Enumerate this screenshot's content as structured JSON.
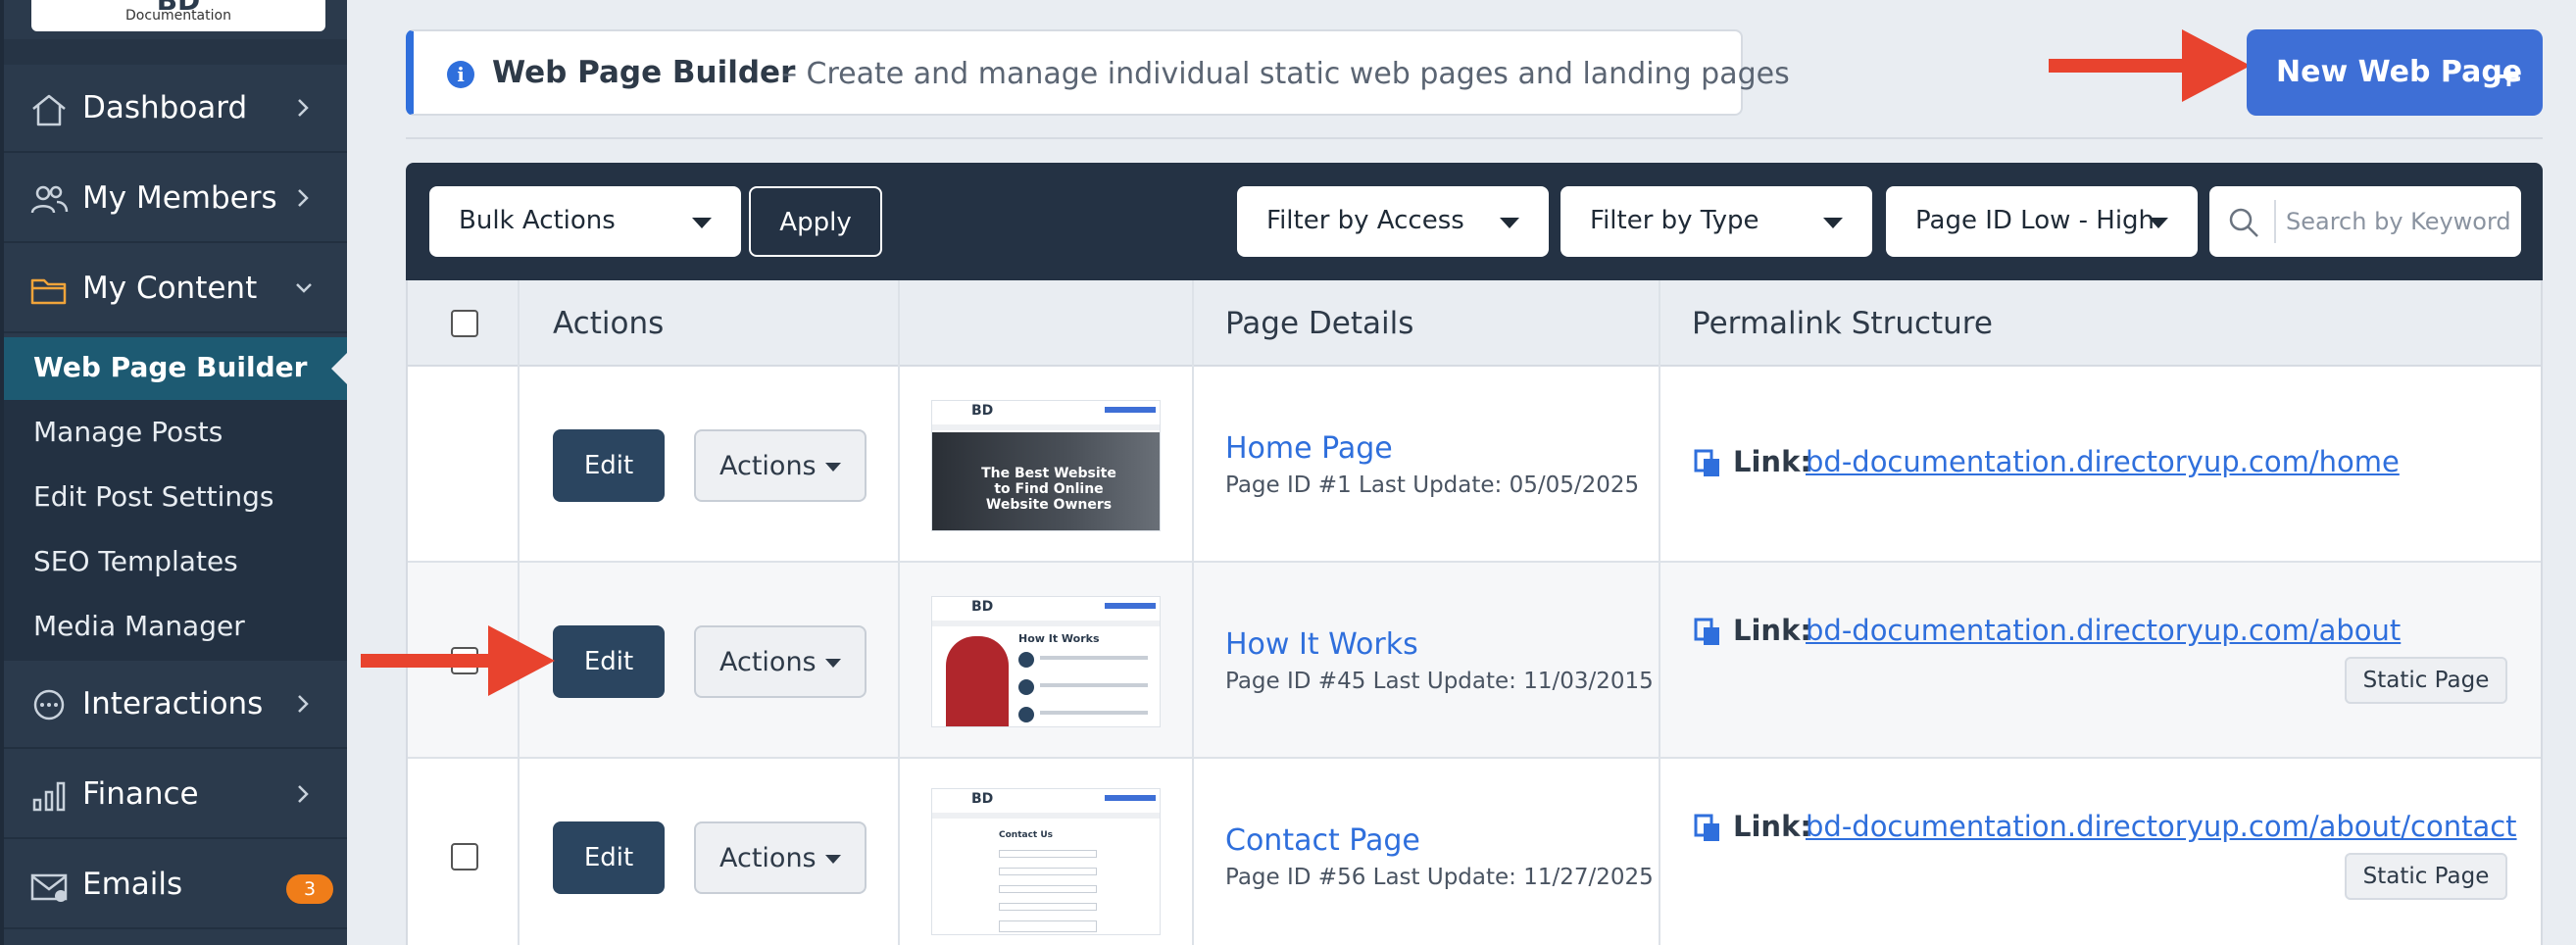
{
  "sidebar": {
    "logo_text": "Documentation",
    "logo_mark": "BD",
    "items": [
      {
        "label": "Dashboard"
      },
      {
        "label": "My Members"
      },
      {
        "label": "My Content"
      },
      {
        "label": "Interactions"
      },
      {
        "label": "Finance"
      },
      {
        "label": "Emails",
        "badge": "3"
      }
    ],
    "submenu": [
      {
        "label": "Web Page Builder",
        "active": true
      },
      {
        "label": "Manage Posts"
      },
      {
        "label": "Edit Post Settings"
      },
      {
        "label": "SEO Templates"
      },
      {
        "label": "Media Manager"
      }
    ]
  },
  "header": {
    "title": "Web Page Builder",
    "description": "– Create and manage individual static web pages and landing pages",
    "new_button": "New Web Page",
    "new_button_icon": "plus-icon"
  },
  "toolbar": {
    "bulk_actions": "Bulk Actions",
    "apply": "Apply",
    "filter_access": "Filter by Access",
    "filter_type": "Filter by Type",
    "sort": "Page ID Low - High",
    "search_placeholder": "Search by Keyword"
  },
  "table": {
    "columns": [
      "",
      "Actions",
      "",
      "Page Details",
      "Permalink Structure"
    ],
    "rows": [
      {
        "edit": "Edit",
        "actions": "Actions",
        "title": "Home Page",
        "meta": "Page ID #1    Last Update: 05/05/2025",
        "link_label": "Link:",
        "url": "bd-documentation.directoryup.com/home",
        "badge": "",
        "thumb_text": "The Best Website to Find Online Website Owners"
      },
      {
        "edit": "Edit",
        "actions": "Actions",
        "title": "How It Works",
        "meta": "Page ID #45    Last Update: 11/03/2015",
        "link_label": "Link:",
        "url": "bd-documentation.directoryup.com/about",
        "badge": "Static Page",
        "thumb_text": "How It Works"
      },
      {
        "edit": "Edit",
        "actions": "Actions",
        "title": "Contact Page",
        "meta": "Page ID #56    Last Update: 11/27/2025",
        "link_label": "Link:",
        "url": "bd-documentation.directoryup.com/about/contact",
        "badge": "Static Page",
        "thumb_text": "Contact Us"
      }
    ]
  },
  "colors": {
    "sidebar": "#2b3a4c",
    "accent": "#3e6fd6",
    "active_sub": "#1d5a72",
    "badge": "#f07d19",
    "arrow": "#e8432e"
  }
}
